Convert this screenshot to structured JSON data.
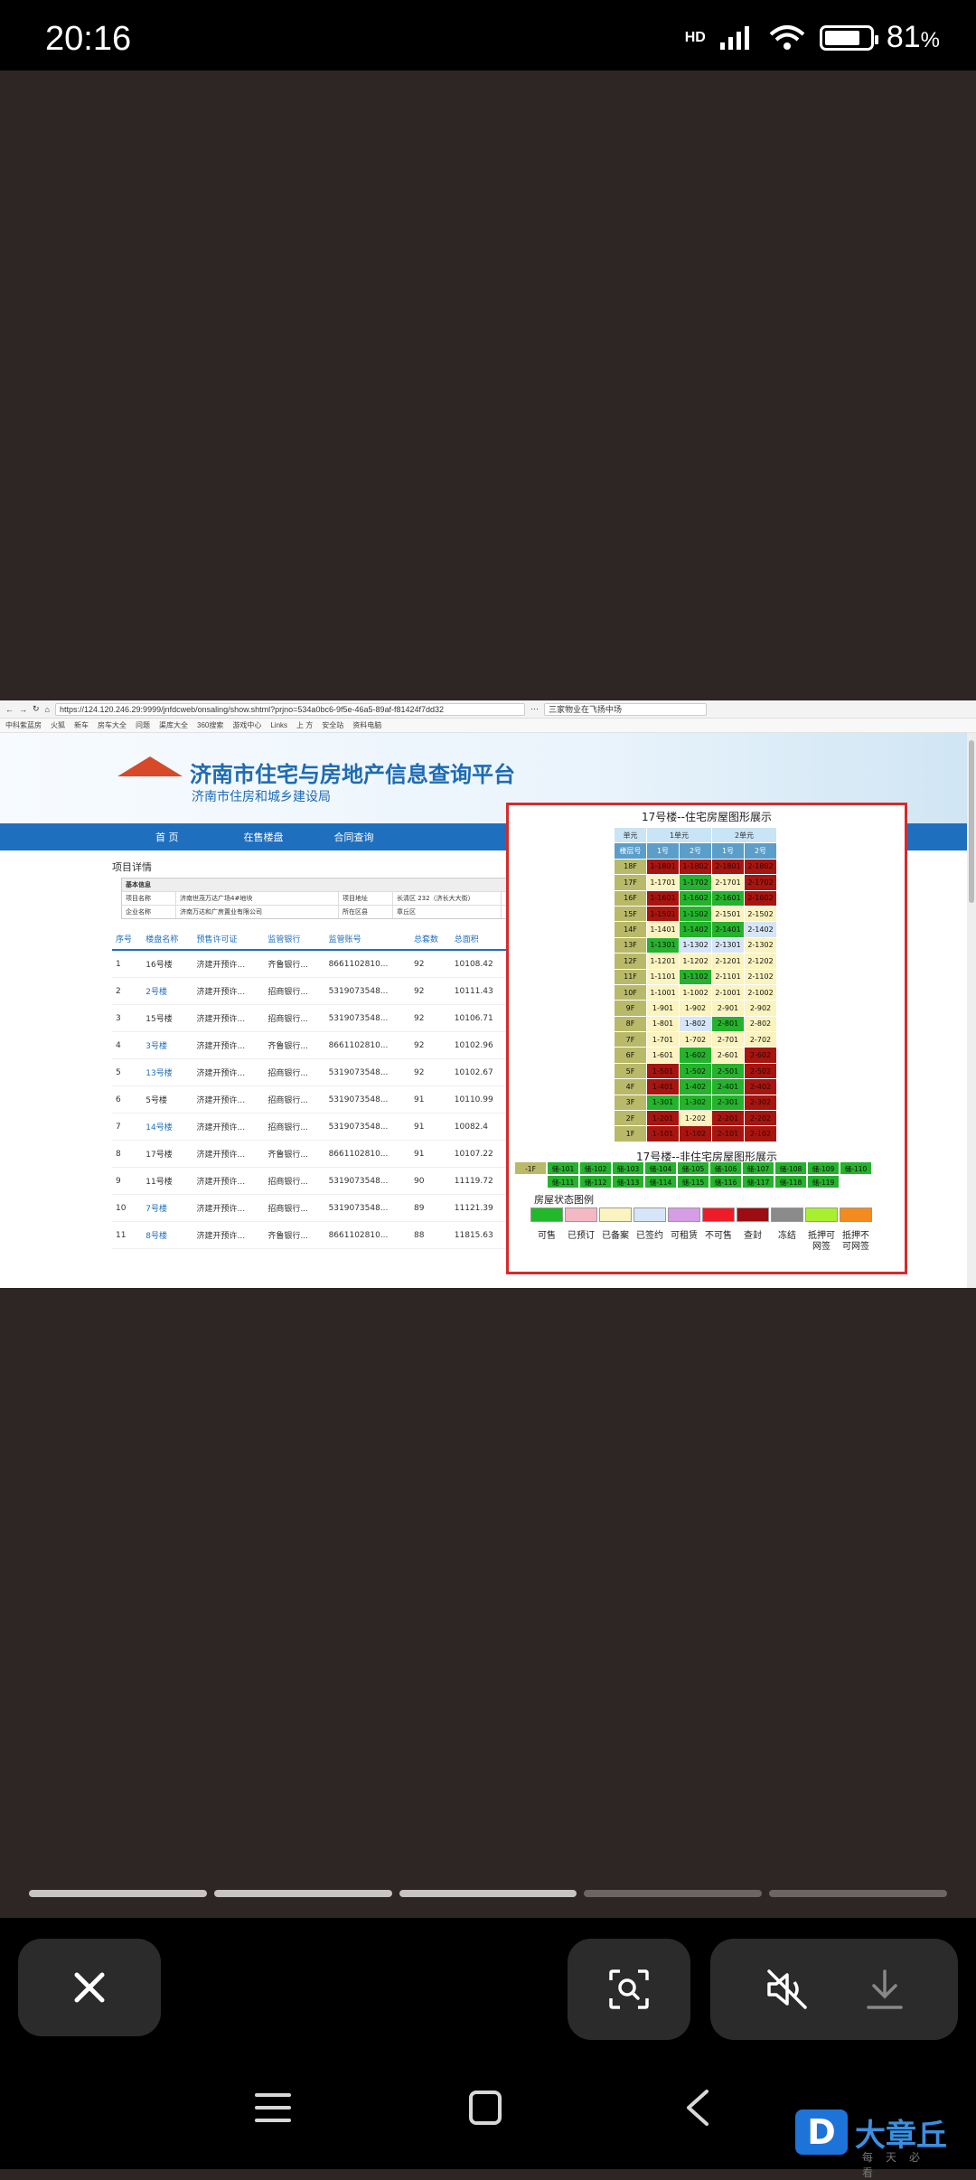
{
  "status_bar": {
    "time": "20:16",
    "network": "HD",
    "battery_percent": "81",
    "battery_level": 0.81
  },
  "browser": {
    "url": "https://124.120.246.29:9999/jnfdcweb/onsaling/show.shtml?prjno=534a0bc6-9f5e-46a5-89af-f81424f7dd32",
    "search_placeholder": "三家物业在飞扬中场",
    "bookmarks": [
      "中科紫蓝房",
      "火狐",
      "新车",
      "房车大全",
      "问题",
      "渠库大全",
      "360搜索",
      "游戏中心",
      "Links",
      "上 方",
      "安全站",
      "资料电脑"
    ]
  },
  "site": {
    "title": "济南市住宅与房地产信息查询平台",
    "subtitle": "济南市住房和城乡建设局",
    "nav": [
      "首 页",
      "在售楼盘",
      "合同查询"
    ]
  },
  "project": {
    "section_title": "项目详情",
    "basic_header": "基本信息",
    "basic_rows": [
      [
        "项目名称",
        "济南世茂万达广场4#地块",
        "项目地址",
        "长清区 232（济长大大街）"
      ],
      [
        "企业名称",
        "济南万达和广房置业有限公司",
        "所在区县",
        "章丘区"
      ]
    ],
    "columns": [
      "序号",
      "楼盘名称",
      "预售许可证",
      "监管银行",
      "监管账号",
      "总套数",
      "总面积"
    ],
    "rows": [
      [
        "1",
        "16号楼",
        "济建开预许...",
        "齐鲁银行...",
        "8661102810...",
        "92",
        "10108.42",
        false
      ],
      [
        "2",
        "2号楼",
        "济建开预许...",
        "招商银行...",
        "5319073548...",
        "92",
        "10111.43",
        true
      ],
      [
        "3",
        "15号楼",
        "济建开预许...",
        "招商银行...",
        "5319073548...",
        "92",
        "10106.71",
        false
      ],
      [
        "4",
        "3号楼",
        "济建开预许...",
        "齐鲁银行...",
        "8661102810...",
        "92",
        "10102.96",
        true
      ],
      [
        "5",
        "13号楼",
        "济建开预许...",
        "招商银行...",
        "5319073548...",
        "92",
        "10102.67",
        true
      ],
      [
        "6",
        "5号楼",
        "济建开预许...",
        "招商银行...",
        "5319073548...",
        "91",
        "10110.99",
        false
      ],
      [
        "7",
        "14号楼",
        "济建开预许...",
        "招商银行...",
        "5319073548...",
        "91",
        "10082.4",
        true
      ],
      [
        "8",
        "17号楼",
        "济建开预许...",
        "齐鲁银行...",
        "8661102810...",
        "91",
        "10107.22",
        false
      ],
      [
        "9",
        "11号楼",
        "济建开预许...",
        "招商银行...",
        "5319073548...",
        "90",
        "11119.72",
        false
      ],
      [
        "10",
        "7号楼",
        "济建开预许...",
        "招商银行...",
        "5319073548...",
        "89",
        "11121.39",
        true
      ],
      [
        "11",
        "8号楼",
        "济建开预许...",
        "齐鲁银行...",
        "8661102810...",
        "88",
        "11815.63",
        true
      ]
    ]
  },
  "popup": {
    "title": "17号楼--住宅房屋图形展示",
    "unit_labels": [
      "单元",
      "1单元",
      "2单元"
    ],
    "sub_labels": [
      "楼层号",
      "1号",
      "2号",
      "1号",
      "2号"
    ],
    "floors": [
      {
        "f": "18F",
        "rooms": [
          [
            "1-1801",
            "red"
          ],
          [
            "1-1802",
            "red"
          ],
          [
            "2-1801",
            "red"
          ],
          [
            "2-1802",
            "red"
          ]
        ]
      },
      {
        "f": "17F",
        "rooms": [
          [
            "1-1701",
            "cream"
          ],
          [
            "1-1702",
            "green"
          ],
          [
            "2-1701",
            "cream"
          ],
          [
            "2-1702",
            "red"
          ]
        ]
      },
      {
        "f": "16F",
        "rooms": [
          [
            "1-1601",
            "red"
          ],
          [
            "1-1602",
            "green"
          ],
          [
            "2-1601",
            "green"
          ],
          [
            "2-1602",
            "red"
          ]
        ]
      },
      {
        "f": "15F",
        "rooms": [
          [
            "1-1501",
            "red"
          ],
          [
            "1-1502",
            "green"
          ],
          [
            "2-1501",
            "cream"
          ],
          [
            "2-1502",
            "cream"
          ]
        ]
      },
      {
        "f": "14F",
        "rooms": [
          [
            "1-1401",
            "cream"
          ],
          [
            "1-1402",
            "green"
          ],
          [
            "2-1401",
            "green"
          ],
          [
            "2-1402",
            "blue"
          ]
        ]
      },
      {
        "f": "13F",
        "rooms": [
          [
            "1-1301",
            "green"
          ],
          [
            "1-1302",
            "blue"
          ],
          [
            "2-1301",
            "blue"
          ],
          [
            "2-1302",
            "cream"
          ]
        ]
      },
      {
        "f": "12F",
        "rooms": [
          [
            "1-1201",
            "cream"
          ],
          [
            "1-1202",
            "cream"
          ],
          [
            "2-1201",
            "cream"
          ],
          [
            "2-1202",
            "cream"
          ]
        ]
      },
      {
        "f": "11F",
        "rooms": [
          [
            "1-1101",
            "cream"
          ],
          [
            "1-1102",
            "green"
          ],
          [
            "2-1101",
            "cream"
          ],
          [
            "2-1102",
            "cream"
          ]
        ]
      },
      {
        "f": "10F",
        "rooms": [
          [
            "1-1001",
            "cream"
          ],
          [
            "1-1002",
            "cream"
          ],
          [
            "2-1001",
            "cream"
          ],
          [
            "2-1002",
            "cream"
          ]
        ]
      },
      {
        "f": "9F",
        "rooms": [
          [
            "1-901",
            "cream"
          ],
          [
            "1-902",
            "cream"
          ],
          [
            "2-901",
            "cream"
          ],
          [
            "2-902",
            "cream"
          ]
        ]
      },
      {
        "f": "8F",
        "rooms": [
          [
            "1-801",
            "cream"
          ],
          [
            "1-802",
            "blue"
          ],
          [
            "2-801",
            "green"
          ],
          [
            "2-802",
            "cream"
          ]
        ]
      },
      {
        "f": "7F",
        "rooms": [
          [
            "1-701",
            "cream"
          ],
          [
            "1-702",
            "cream"
          ],
          [
            "2-701",
            "cream"
          ],
          [
            "2-702",
            "cream"
          ]
        ]
      },
      {
        "f": "6F",
        "rooms": [
          [
            "1-601",
            "cream"
          ],
          [
            "1-602",
            "green"
          ],
          [
            "2-601",
            "cream"
          ],
          [
            "2-602",
            "red"
          ]
        ]
      },
      {
        "f": "5F",
        "rooms": [
          [
            "1-501",
            "red"
          ],
          [
            "1-502",
            "green"
          ],
          [
            "2-501",
            "green"
          ],
          [
            "2-502",
            "red"
          ]
        ]
      },
      {
        "f": "4F",
        "rooms": [
          [
            "1-401",
            "red"
          ],
          [
            "1-402",
            "green"
          ],
          [
            "2-401",
            "green"
          ],
          [
            "2-402",
            "red"
          ]
        ]
      },
      {
        "f": "3F",
        "rooms": [
          [
            "1-301",
            "green"
          ],
          [
            "1-302",
            "green"
          ],
          [
            "2-301",
            "green"
          ],
          [
            "2-302",
            "red"
          ]
        ]
      },
      {
        "f": "2F",
        "rooms": [
          [
            "1-201",
            "red"
          ],
          [
            "1-202",
            "cream"
          ],
          [
            "2-201",
            "red"
          ],
          [
            "2-202",
            "red"
          ]
        ]
      },
      {
        "f": "1F",
        "rooms": [
          [
            "1-101",
            "red"
          ],
          [
            "1-102",
            "red"
          ],
          [
            "2-101",
            "red"
          ],
          [
            "2-102",
            "red"
          ]
        ]
      }
    ],
    "title2": "17号楼--非住宅房屋图形展示",
    "nonres": [
      [
        "-1F",
        "floor"
      ],
      [
        "储-101",
        "green"
      ],
      [
        "储-102",
        "green"
      ],
      [
        "储-103",
        "green"
      ],
      [
        "储-104",
        "green"
      ],
      [
        "储-105",
        "green"
      ],
      [
        "储-106",
        "green"
      ],
      [
        "储-107",
        "green"
      ],
      [
        "储-108",
        "green"
      ],
      [
        "储-109",
        "green"
      ],
      [
        "储-110",
        "green"
      ],
      [
        "储-111",
        "green"
      ],
      [
        "储-112",
        "green"
      ],
      [
        "储-113",
        "green"
      ],
      [
        "储-114",
        "green"
      ],
      [
        "储-115",
        "green"
      ],
      [
        "储-116",
        "green"
      ],
      [
        "储-117",
        "green"
      ],
      [
        "储-118",
        "green"
      ],
      [
        "储-119",
        "green"
      ]
    ],
    "legend_title": "房屋状态图例",
    "legend": [
      {
        "label": "可售",
        "color": "#21b82a"
      },
      {
        "label": "已预订",
        "color": "#f4b8c4"
      },
      {
        "label": "已备案",
        "color": "#fbf3c0"
      },
      {
        "label": "已签约",
        "color": "#d6e6f8"
      },
      {
        "label": "可租赁",
        "color": "#d79ce6"
      },
      {
        "label": "不可售",
        "color": "#ee1c28"
      },
      {
        "label": "查封",
        "color": "#9c0c10"
      },
      {
        "label": "冻结",
        "color": "#8a8a8a"
      },
      {
        "label": "抵押可网签",
        "color": "#a8ef30"
      },
      {
        "label": "抵押不可网签",
        "color": "#f58a1e"
      }
    ]
  },
  "status_colors": {
    "red": "#a6150f",
    "green": "#25b22c",
    "cream": "#fbf3c0",
    "blue": "#d6e6f8",
    "floor": "#b9b96a"
  },
  "story_progress": {
    "segments": 5,
    "viewed": 3
  },
  "watermark": {
    "brand": "大章丘",
    "tagline": "每天必看",
    "mark": "D"
  }
}
